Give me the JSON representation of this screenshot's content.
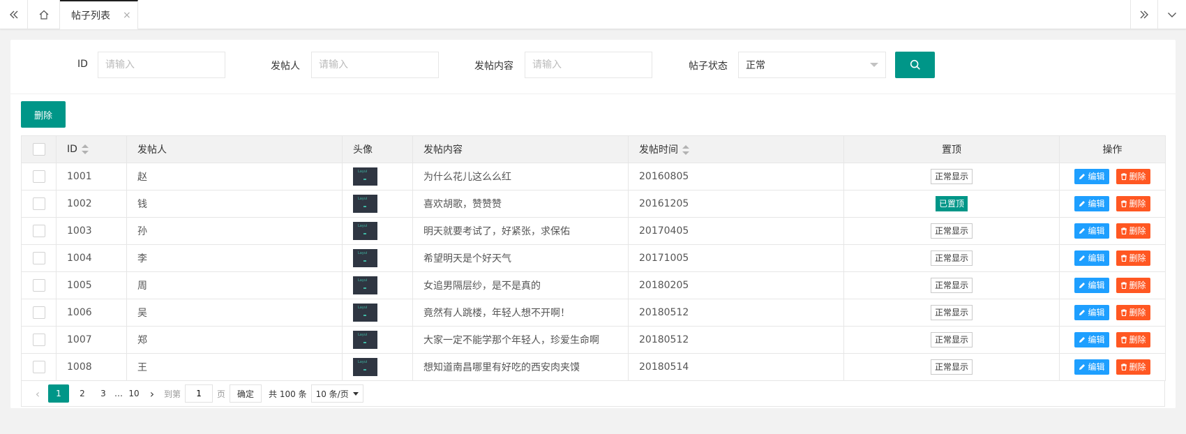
{
  "tabbar": {
    "active_tab": "帖子列表",
    "close_glyph": "×",
    "icons": [
      "double-chevron-left-icon",
      "home-icon",
      "double-chevron-right-icon",
      "chevron-down-icon"
    ]
  },
  "search": {
    "id_label": "ID",
    "poster_label": "发帖人",
    "content_label": "发帖内容",
    "status_label": "帖子状态",
    "placeholder": "请输入",
    "status_value": "正常",
    "search_icon": "search-icon"
  },
  "toolbar": {
    "delete_label": "删除"
  },
  "table": {
    "headers": {
      "id": "ID",
      "poster": "发帖人",
      "avatar": "头像",
      "content": "发帖内容",
      "time": "发帖时间",
      "top": "置顶",
      "ops": "操作"
    },
    "avatar_text": "Layui",
    "edit_label": "编辑",
    "delete_label": "删除",
    "rows": [
      {
        "id": "1001",
        "poster": "赵",
        "content": "为什么花儿这么么红",
        "time": "20160805",
        "top": "正常显示",
        "pinned": false
      },
      {
        "id": "1002",
        "poster": "钱",
        "content": "喜欢胡歌，赞赞赞",
        "time": "20161205",
        "top": "已置顶",
        "pinned": true
      },
      {
        "id": "1003",
        "poster": "孙",
        "content": "明天就要考试了，好紧张，求保佑",
        "time": "20170405",
        "top": "正常显示",
        "pinned": false
      },
      {
        "id": "1004",
        "poster": "李",
        "content": "希望明天是个好天气",
        "time": "20171005",
        "top": "正常显示",
        "pinned": false
      },
      {
        "id": "1005",
        "poster": "周",
        "content": "女追男隔层纱，是不是真的",
        "time": "20180205",
        "top": "正常显示",
        "pinned": false
      },
      {
        "id": "1006",
        "poster": "吴",
        "content": "竟然有人跳楼，年轻人想不开啊！",
        "time": "20180512",
        "top": "正常显示",
        "pinned": false
      },
      {
        "id": "1007",
        "poster": "郑",
        "content": "大家一定不能学那个年轻人，珍爱生命啊",
        "time": "20180512",
        "top": "正常显示",
        "pinned": false
      },
      {
        "id": "1008",
        "poster": "王",
        "content": "想知道南昌哪里有好吃的西安肉夹馍",
        "time": "20180514",
        "top": "正常显示",
        "pinned": false
      }
    ]
  },
  "pager": {
    "current": "1",
    "p2": "2",
    "p3": "3",
    "ellipsis": "…",
    "last": "10",
    "goto_prefix": "到第",
    "goto_value": "1",
    "goto_suffix": "页",
    "confirm": "确定",
    "total": "共 100 条",
    "page_size": "10 条/页"
  },
  "colors": {
    "primary": "#009688",
    "edit": "#1e9fff",
    "danger": "#ff5722"
  }
}
